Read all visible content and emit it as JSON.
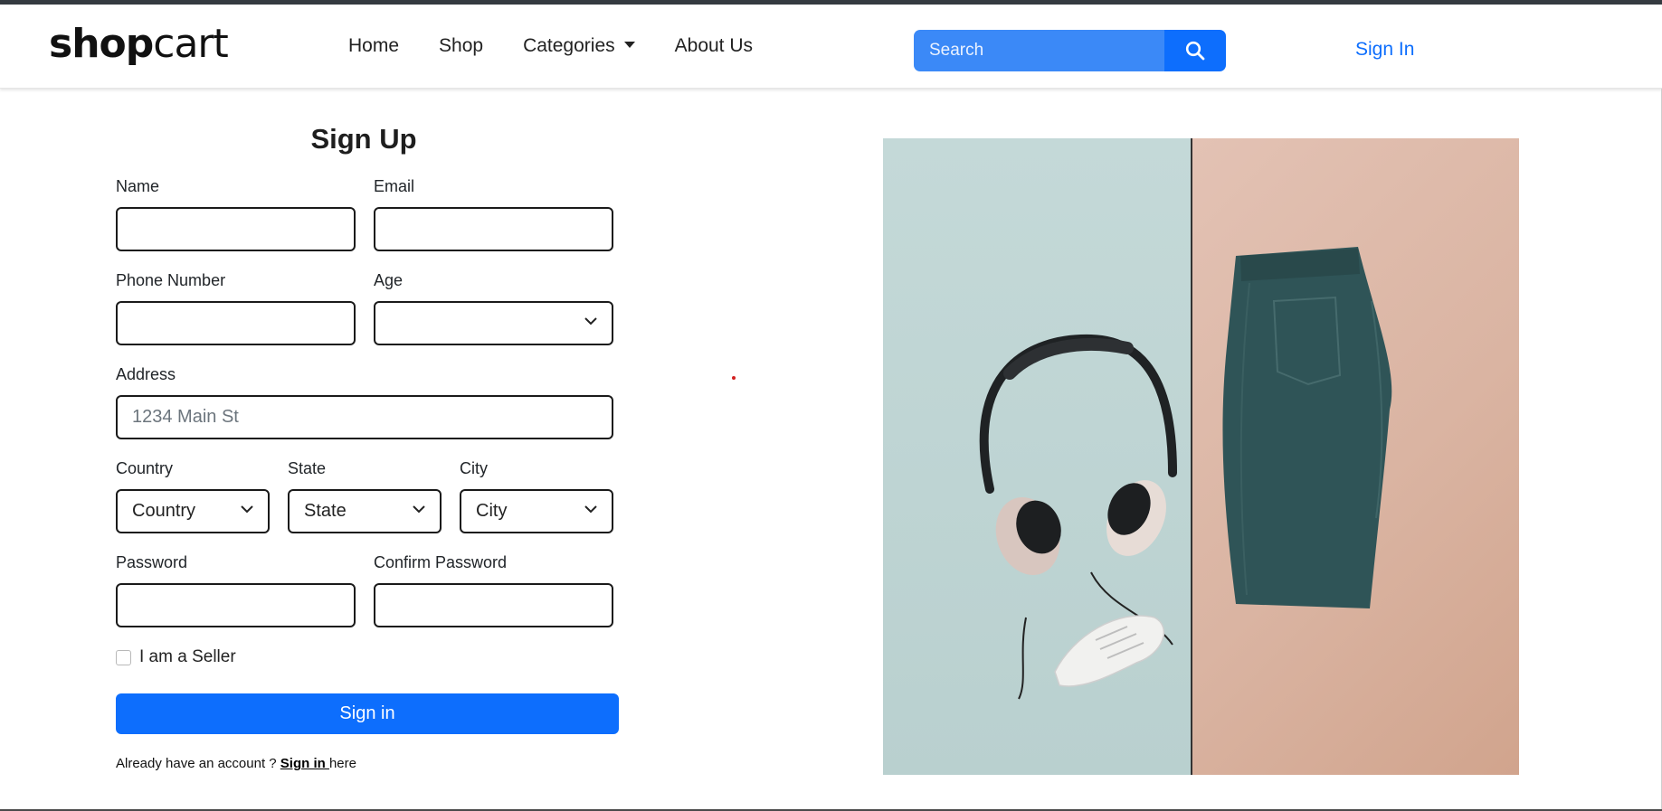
{
  "brand": {
    "bold": "shop",
    "light": "cart"
  },
  "nav": {
    "links": [
      "Home",
      "Shop",
      "Categories",
      "About Us"
    ],
    "categories_has_dropdown": true,
    "search_placeholder": "Search",
    "search_icon": "search-icon",
    "signin_label": "Sign In"
  },
  "form": {
    "title": "Sign Up",
    "name_label": "Name",
    "email_label": "Email",
    "phone_label": "Phone Number",
    "age_label": "Age",
    "age_value": "",
    "address_label": "Address",
    "address_placeholder": "1234 Main St",
    "country_label": "Country",
    "country_value": "Country",
    "state_label": "State",
    "state_value": "State",
    "city_label": "City",
    "city_value": "City",
    "password_label": "Password",
    "confirm_password_label": "Confirm Password",
    "seller_checkbox_label": "I am a Seller",
    "seller_checked": false,
    "submit_label": "Sign in",
    "footer_prefix": "Already have an account ? ",
    "footer_link": "Sign in ",
    "footer_suffix": "here"
  },
  "hero": {
    "image_subject": "headphones, sneakers and denim jeans flat lay",
    "left_color": "#c4d9d8",
    "right_color": "#dab4a2"
  },
  "colors": {
    "primary": "#0d6efd",
    "search_bg": "#3b89f7",
    "text": "#212529"
  }
}
